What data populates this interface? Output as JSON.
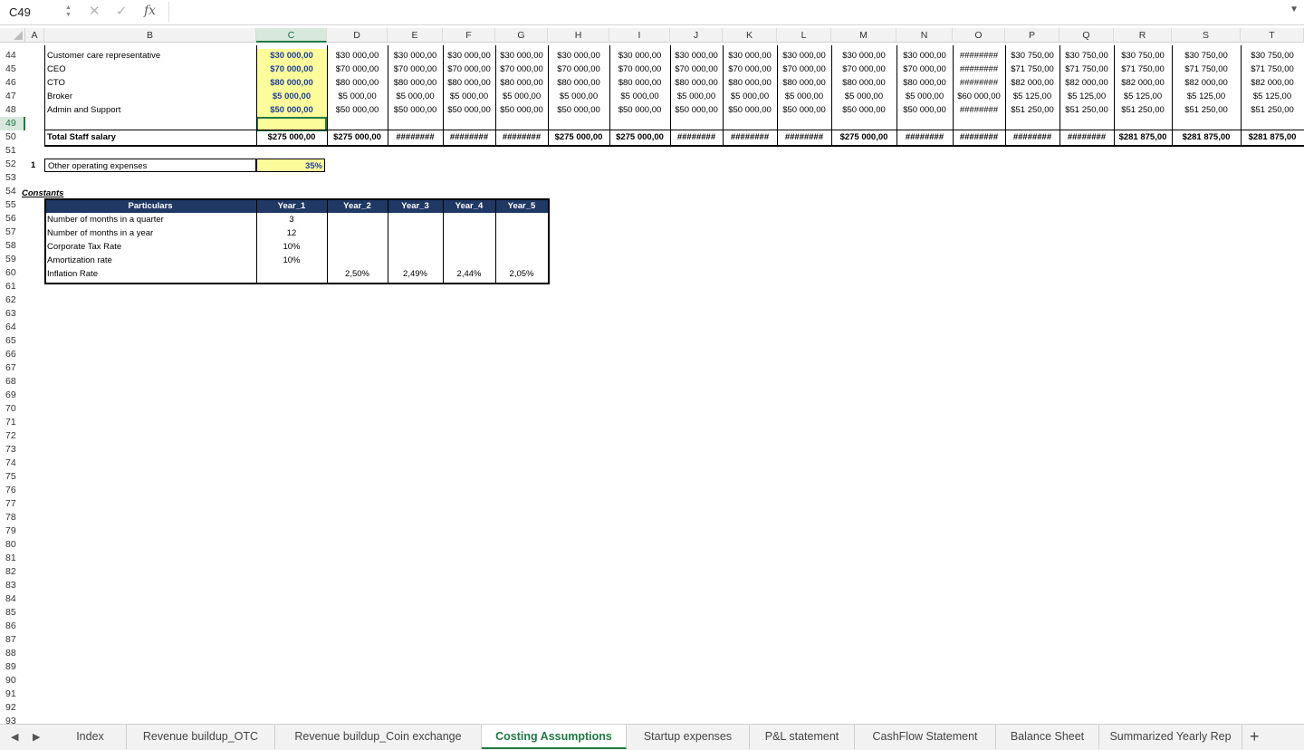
{
  "formula_bar": {
    "name_box": "C49",
    "cancel_icon": "✕",
    "confirm_icon": "✓",
    "fx_label": "fx",
    "formula": ""
  },
  "columns": [
    "A",
    "B",
    "C",
    "D",
    "E",
    "F",
    "G",
    "H",
    "I",
    "J",
    "K",
    "L",
    "M",
    "N",
    "O",
    "P",
    "Q",
    "R",
    "S",
    "T"
  ],
  "selected_column": "C",
  "rows": [
    "44",
    "45",
    "46",
    "47",
    "48",
    "49",
    "50",
    "51",
    "52",
    "53",
    "54",
    "55",
    "56",
    "57",
    "58",
    "59",
    "60",
    "61",
    "62",
    "63",
    "64",
    "65",
    "66",
    "67",
    "68",
    "69",
    "70",
    "71",
    "72",
    "73",
    "74",
    "75",
    "76",
    "77",
    "78",
    "79",
    "80",
    "81",
    "82",
    "83",
    "84",
    "85",
    "86",
    "87",
    "88",
    "89",
    "90",
    "91",
    "92",
    "93"
  ],
  "selected_row": "49",
  "staff": {
    "rows": [
      {
        "label": "Customer care representative",
        "values": [
          "$30 000,00",
          "$30 000,00",
          "$30 000,00",
          "$30 000,00",
          "$30 000,00",
          "$30 000,00",
          "$30 000,00",
          "$30 000,00",
          "$30 000,00",
          "$30 000,00",
          "$30 000,00",
          "$30 000,00",
          "########",
          "$30 750,00",
          "$30 750,00",
          "$30 750,00",
          "$30 750,00",
          "$30 750,00"
        ]
      },
      {
        "label": "CEO",
        "values": [
          "$70 000,00",
          "$70 000,00",
          "$70 000,00",
          "$70 000,00",
          "$70 000,00",
          "$70 000,00",
          "$70 000,00",
          "$70 000,00",
          "$70 000,00",
          "$70 000,00",
          "$70 000,00",
          "$70 000,00",
          "########",
          "$71 750,00",
          "$71 750,00",
          "$71 750,00",
          "$71 750,00",
          "$71 750,00"
        ]
      },
      {
        "label": "CTO",
        "values": [
          "$80 000,00",
          "$80 000,00",
          "$80 000,00",
          "$80 000,00",
          "$80 000,00",
          "$80 000,00",
          "$80 000,00",
          "$80 000,00",
          "$80 000,00",
          "$80 000,00",
          "$80 000,00",
          "$80 000,00",
          "########",
          "$82 000,00",
          "$82 000,00",
          "$82 000,00",
          "$82 000,00",
          "$82 000,00"
        ]
      },
      {
        "label": "Broker",
        "values": [
          "$5 000,00",
          "$5 000,00",
          "$5 000,00",
          "$5 000,00",
          "$5 000,00",
          "$5 000,00",
          "$5 000,00",
          "$5 000,00",
          "$5 000,00",
          "$5 000,00",
          "$5 000,00",
          "$5 000,00",
          "$60 000,00",
          "$5 125,00",
          "$5 125,00",
          "$5 125,00",
          "$5 125,00",
          "$5 125,00"
        ]
      },
      {
        "label": "Admin and Support",
        "values": [
          "$50 000,00",
          "$50 000,00",
          "$50 000,00",
          "$50 000,00",
          "$50 000,00",
          "$50 000,00",
          "$50 000,00",
          "$50 000,00",
          "$50 000,00",
          "$50 000,00",
          "$50 000,00",
          "$50 000,00",
          "########",
          "$51 250,00",
          "$51 250,00",
          "$51 250,00",
          "$51 250,00",
          "$51 250,00"
        ]
      }
    ],
    "total_label": "Total Staff salary",
    "total_values": [
      "$275 000,00",
      "$275 000,00",
      "########",
      "########",
      "########",
      "$275 000,00",
      "$275 000,00",
      "########",
      "########",
      "########",
      "$275 000,00",
      "########",
      "########",
      "########",
      "########",
      "$281 875,00",
      "$281 875,00",
      "$281 875,00"
    ]
  },
  "other_opex": {
    "index": "1",
    "label": "Other operating expenses",
    "value": "35%"
  },
  "constants": {
    "title": "Constants",
    "headers": [
      "Particulars",
      "Year_1",
      "Year_2",
      "Year_3",
      "Year_4",
      "Year_5"
    ],
    "rows": [
      {
        "label": "Number of months in a quarter",
        "values": [
          "3",
          "",
          "",
          "",
          ""
        ]
      },
      {
        "label": "Number of months in a year",
        "values": [
          "12",
          "",
          "",
          "",
          ""
        ]
      },
      {
        "label": "Corporate Tax Rate",
        "values": [
          "10%",
          "",
          "",
          "",
          ""
        ]
      },
      {
        "label": "Amortization rate",
        "values": [
          "10%",
          "",
          "",
          "",
          ""
        ]
      },
      {
        "label": "Inflation Rate",
        "values": [
          "",
          "2,50%",
          "2,49%",
          "2,44%",
          "2,05%"
        ]
      }
    ]
  },
  "sheet_tabs": [
    "Index",
    "Revenue buildup_OTC",
    "Revenue buildup_Coin exchange",
    "Costing Assumptions",
    "Startup expenses",
    "P&L statement",
    "CashFlow Statement",
    "Balance Sheet",
    "Summarized Yearly Rep"
  ],
  "active_tab": "Costing Assumptions",
  "add_sheet_label": "+"
}
